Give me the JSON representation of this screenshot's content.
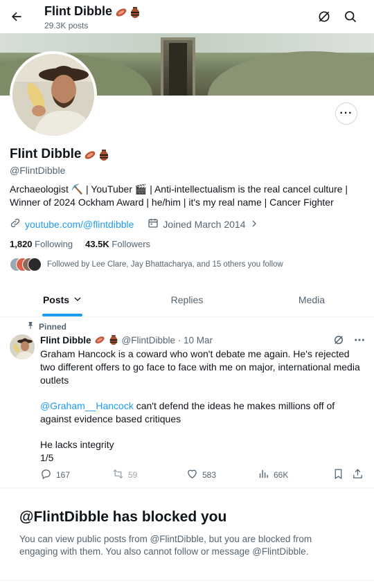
{
  "header": {
    "name": "Flint Dibble",
    "post_count": "29.3K posts"
  },
  "profile": {
    "name": "Flint Dibble",
    "handle": "@FlintDibble",
    "bio_line1": "Archaeologist ⛏️ | YouTuber 🎬 | Anti-intellectualism is the real cancel culture |",
    "bio_line2": "Winner of 2024 Ockham Award | he/him | it's my real name | Cancer Fighter",
    "website": "youtube.com/@flintdibble",
    "joined": "Joined March 2014",
    "following_count": "1,820",
    "following_label": "Following",
    "followers_count": "43.5K",
    "followers_label": "Followers",
    "followed_by": "Followed by Lee Clare, Jay Bhattacharya, and 15 others you follow"
  },
  "tabs": [
    {
      "label": "Posts"
    },
    {
      "label": "Replies"
    },
    {
      "label": "Media"
    }
  ],
  "pinned_post": {
    "pinned_label": "Pinned",
    "author": "Flint Dibble",
    "handle_date": "@FlintDibble · 10 Mar",
    "para1": "Graham Hancock is a coward who won't debate me again. He's rejected two different offers to go face to face with me on major, international media outlets",
    "mention": "@Graham__Hancock",
    "para2_rest": " can't defend the ideas he makes millions off of against evidence based critiques",
    "para3_line1": "He lacks integrity",
    "para3_line2": "1/5",
    "replies": "167",
    "reposts": "59",
    "likes": "583",
    "views": "66K"
  },
  "blocked": {
    "title": "@FlintDibble has blocked you",
    "text": "You can view public posts from @FlintDibble, but you are blocked from engaging with them. You also cannot follow or message @FlintDibble."
  },
  "colors": {
    "accent": "#1d9bf0",
    "text": "#0f1419",
    "muted": "#536471",
    "border": "#eff3f4"
  }
}
